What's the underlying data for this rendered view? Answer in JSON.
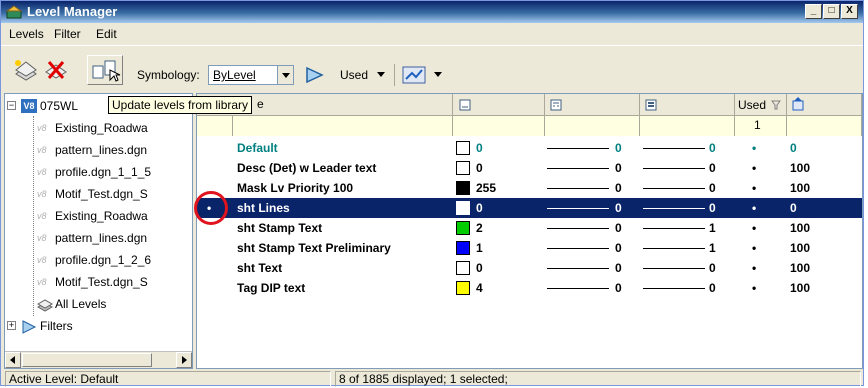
{
  "window": {
    "title": "Level Manager",
    "controls": {
      "minimize": "_",
      "maximize": "□",
      "close": "X"
    }
  },
  "menu": {
    "items": [
      "Levels",
      "Filter",
      "Edit"
    ]
  },
  "toolbar": {
    "symbology_label": "Symbology:",
    "symbology_value": "ByLevel",
    "used_label": "Used"
  },
  "tooltip": "Update levels from library",
  "tree": {
    "root": "075WL",
    "children": [
      "Existing_Roadwa",
      "pattern_lines.dgn",
      "profile.dgn_1_1_5",
      "Motif_Test.dgn_S",
      "Existing_Roadwa",
      "pattern_lines.dgn",
      "profile.dgn_1_2_6",
      "Motif_Test.dgn_S"
    ],
    "all_levels": "All Levels",
    "filters": "Filters"
  },
  "grid": {
    "header_name_fragment": "e",
    "header_used": "Used",
    "filter_used_value": "1",
    "rows": [
      {
        "name": "Default",
        "color": "#ffffff",
        "color_num": "0",
        "style": "0",
        "weight": "0",
        "used_mark": "•",
        "used": "0",
        "active": true
      },
      {
        "name": "Desc (Det) w Leader text",
        "color": "#ffffff",
        "color_num": "0",
        "style": "0",
        "weight": "0",
        "used_mark": "•",
        "used": "100"
      },
      {
        "name": "Mask Lv Priority 100",
        "color": "#000000",
        "color_num": "255",
        "style": "0",
        "weight": "0",
        "used_mark": "•",
        "used": "100"
      },
      {
        "name": "sht Lines",
        "color": "#ffffff",
        "color_num": "0",
        "style": "0",
        "weight": "0",
        "used_mark": "•",
        "used": "0",
        "selected": true,
        "marker": "•"
      },
      {
        "name": "sht Stamp Text",
        "color": "#00cc00",
        "color_num": "2",
        "style": "0",
        "weight": "1",
        "used_mark": "•",
        "used": "100"
      },
      {
        "name": "sht Stamp Text Preliminary",
        "color": "#0000ff",
        "color_num": "1",
        "style": "0",
        "weight": "1",
        "used_mark": "•",
        "used": "100"
      },
      {
        "name": "sht Text",
        "color": "#ffffff",
        "color_num": "0",
        "style": "0",
        "weight": "0",
        "used_mark": "•",
        "used": "100"
      },
      {
        "name": "Tag DIP text",
        "color": "#ffff00",
        "color_num": "4",
        "style": "0",
        "weight": "0",
        "used_mark": "•",
        "used": "100"
      }
    ]
  },
  "status": {
    "active_level": "Active Level: Default",
    "displayed": "8 of 1885 displayed; 1 selected;"
  },
  "colors": {
    "accent_teal": "#008080",
    "selection": "#0a246a",
    "highlight_circle": "#e0141e"
  }
}
